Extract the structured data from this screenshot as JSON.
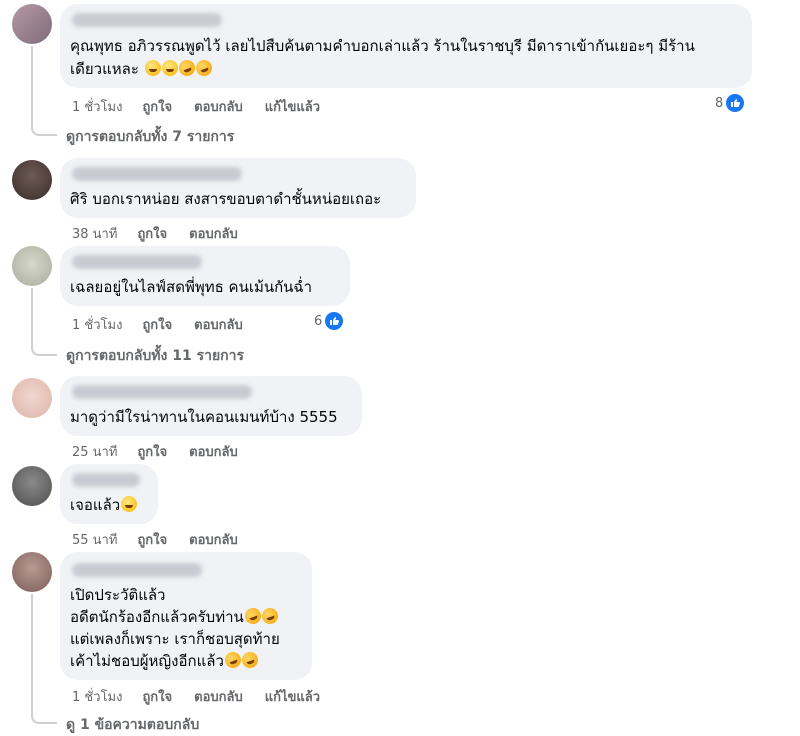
{
  "colors": {
    "bubble": "#f0f2f5",
    "meta_text": "#65676b",
    "like_blue": "#1877f2"
  },
  "comments": [
    {
      "text_lines": [
        "คุณพุทธ อภิวรรณพูดไว้ เลยไปสืบค้นตามคำบอกเล่าแล้ว ร้านในราชบุรี มีดาราเข้ากันเยอะๆ มีร้าน",
        "เดียวแหละ"
      ],
      "emojis": [
        "grin-icon",
        "grin-icon",
        "laugh-tears-icon",
        "laugh-tears-icon"
      ],
      "time": "1 ชั่วโมง",
      "like": "ถูกใจ",
      "reply": "ตอบกลับ",
      "edited": "แก้ไขแล้ว",
      "reaction_count": "8",
      "view_replies": "ดูการตอบกลับทั้ง 7 รายการ"
    },
    {
      "text_lines": [
        "ศิริ บอกเราหน่อย สงสารขอบตาดำชั้นหน่อยเถอะ"
      ],
      "time": "38 นาที",
      "like": "ถูกใจ",
      "reply": "ตอบกลับ"
    },
    {
      "text_lines": [
        "เฉลยอยู่ในไลฟ์สดพี่พุทธ คนเม้นกันฉ่ำ"
      ],
      "time": "1 ชั่วโมง",
      "like": "ถูกใจ",
      "reply": "ตอบกลับ",
      "reaction_count": "6",
      "view_replies": "ดูการตอบกลับทั้ง 11 รายการ"
    },
    {
      "text_lines": [
        "มาดูว่ามีใรน่าทานในคอนเมนท์บ้าง 5555"
      ],
      "time": "25 นาที",
      "like": "ถูกใจ",
      "reply": "ตอบกลับ"
    },
    {
      "text_lines": [
        "เจอแล้ว"
      ],
      "emojis": [
        "grin-icon"
      ],
      "time": "55 นาที",
      "like": "ถูกใจ",
      "reply": "ตอบกลับ"
    },
    {
      "text_lines": [
        "เปิดประวัติแล้ว",
        "อดีตนักร้องอีกแล้วครับท่าน",
        "แต่เพลงก็เพราะ เราก็ชอบสุดท้าย",
        "เค้าไม่ชอบผู้หญิงอีกแล้ว"
      ],
      "time": "1 ชั่วโมง",
      "like": "ถูกใจ",
      "reply": "ตอบกลับ",
      "edited": "แก้ไขแล้ว",
      "view_replies": "ดู 1 ข้อความตอบกลับ"
    }
  ]
}
